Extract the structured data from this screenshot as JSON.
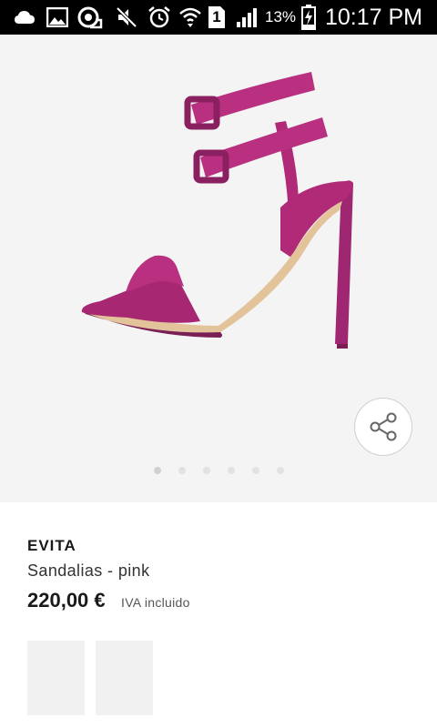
{
  "status_bar": {
    "battery_percent": "13%",
    "time": "10:17 PM",
    "sim_slot": "1",
    "icons": [
      "cloud-icon",
      "image-icon",
      "location-sync-icon",
      "mute-icon",
      "alarm-icon",
      "wifi-icon",
      "sim-icon",
      "signal-icon",
      "battery-charging-icon"
    ]
  },
  "gallery": {
    "image_icon": "pink-high-heel-sandal",
    "image_colors": {
      "suede": "#b02a78",
      "sole": "#e3c39a"
    },
    "share_icon": "share-icon",
    "page_count": 6,
    "active_page": 1
  },
  "product": {
    "brand": "EVITA",
    "name": "Sandalias - pink",
    "price": "220,00 €",
    "vat_note": "IVA incluido"
  }
}
